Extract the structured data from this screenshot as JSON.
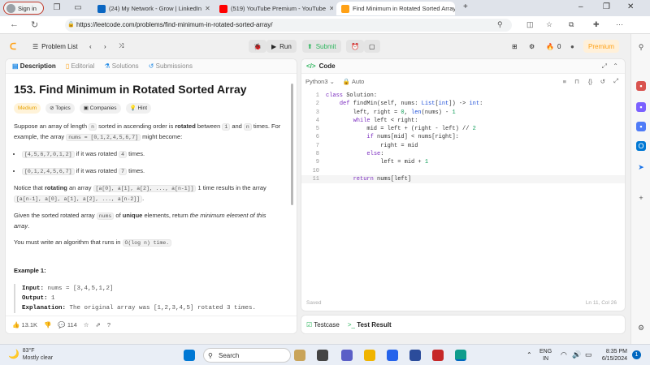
{
  "browser": {
    "signin_label": "Sign in",
    "tabs": [
      {
        "title": "(24) My Network - Grow | LinkedIn",
        "color": "#0a66c2"
      },
      {
        "title": "(519) YouTube Premium - YouTube",
        "color": "#ff0000"
      },
      {
        "title": "Find Minimum in Rotated Sorted Array",
        "color": "#333333"
      }
    ],
    "url": "https://leetcode.com/problems/find-minimum-in-rotated-sorted-array/"
  },
  "lc": {
    "problem_list": "Problem List",
    "run": "Run",
    "submit": "Submit",
    "streak": "0",
    "premium": "Premium"
  },
  "left": {
    "tabs": [
      "Description",
      "Editorial",
      "Solutions",
      "Submissions"
    ],
    "title": "153. Find Minimum in Rotated Sorted Array",
    "chips": [
      "Medium",
      "Topics",
      "Companies",
      "Hint"
    ],
    "p1a": "Suppose an array of length ",
    "p1_n": "n",
    "p1b": " sorted in ascending order is ",
    "p1_bold": "rotated",
    "p1c": " between ",
    "p1_one": "1",
    "p1d": " and ",
    "p1_n2": "n",
    "p1e": " times. For example, the array ",
    "p1_nums": "nums = [0,1,2,4,5,6,7]",
    "p1f": " might become:",
    "b1_code": "[4,5,6,7,0,1,2]",
    "b1a": " if it was rotated ",
    "b1_k": "4",
    "b1b": " times.",
    "b2_code": "[0,1,2,4,5,6,7]",
    "b2a": " if it was rotated ",
    "b2_k": "7",
    "b2b": " times.",
    "p2a": "Notice that ",
    "p2_bold": "rotating",
    "p2b": " an array ",
    "p2_c1": "[a[0], a[1], a[2], ..., a[n-1]]",
    "p2c": " 1 time results in the array ",
    "p2_c2": "[a[n-1], a[0], a[1], a[2], ..., a[n-2]]",
    "p2d": ".",
    "p3a": "Given the sorted rotated array ",
    "p3_nums": "nums",
    "p3b": " of ",
    "p3_bold": "unique",
    "p3c": " elements, return ",
    "p3_em": "the minimum element of this array",
    "p3d": ".",
    "p4a": "You must write an algorithm that runs in ",
    "p4_code": "O(log n) time.",
    "example_title": "Example 1:",
    "ex_input_label": "Input:",
    "ex_input": " nums = [3,4,5,1,2]",
    "ex_output_label": "Output:",
    "ex_output": " 1",
    "ex_expl_label": "Explanation:",
    "ex_expl": " The original array was [1,2,3,4,5] rotated 3 times.",
    "likes": "13.1K",
    "comments": "114"
  },
  "right": {
    "code_title": "Code",
    "lang": "Python3",
    "auto": "Auto",
    "lines": [
      "class Solution:",
      "    def findMin(self, nums: List[int]) -> int:",
      "        left, right = 0, len(nums) - 1",
      "        while left < right:",
      "            mid = left + (right - left) // 2",
      "            if nums[mid] < nums[right]:",
      "                right = mid",
      "            else:",
      "                left = mid + 1",
      "",
      "        return nums[left]"
    ],
    "saved": "Saved",
    "lncol": "Ln 11, Col 26",
    "testcase": "Testcase",
    "testresult": "Test Result"
  },
  "taskbar": {
    "temp": "83°F",
    "weather": "Mostly clear",
    "search": "Search",
    "lang1": "ENG",
    "lang2": "IN",
    "time": "8:35 PM",
    "date": "6/15/2024",
    "notif": "1"
  }
}
